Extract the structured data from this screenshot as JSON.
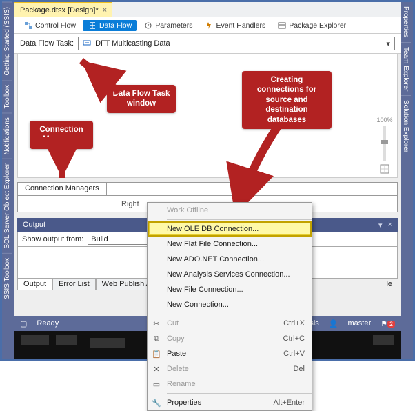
{
  "left_rail": [
    "Getting Started (SSIS)",
    "Toolbox",
    "Notifications",
    "SQL Server Object Explorer",
    "SSIS Toolbox"
  ],
  "right_rail": [
    "Properties",
    "Team Explorer",
    "Solution Explorer"
  ],
  "file_tab": {
    "label": "Package.dtsx [Design]*",
    "close": "×"
  },
  "subtabs": {
    "control_flow": "Control Flow",
    "data_flow": "Data Flow",
    "parameters": "Parameters",
    "event_handlers": "Event Handlers",
    "package_explorer": "Package Explorer"
  },
  "dft": {
    "label": "Data Flow Task:",
    "value": "DFT Multicasting Data"
  },
  "zoom": {
    "pct": "100%"
  },
  "callouts": {
    "c1": "Connection Managers",
    "c2": "Data Flow Task window",
    "c3": "Creating connections for source and destination databases"
  },
  "connection_managers": {
    "tab": "Connection Managers",
    "hint_prefix": "Right"
  },
  "output": {
    "title": "Output",
    "show_label": "Show output from:",
    "show_value": "Build",
    "tabs": [
      "Output",
      "Error List",
      "Web Publish Activity"
    ],
    "trailing": "le"
  },
  "status": {
    "ready": "Ready",
    "db": "ata-ssis",
    "user": "master",
    "notif_count": "2"
  },
  "context_menu": {
    "work_offline": "Work Offline",
    "new_oledb": "New OLE DB Connection...",
    "new_flat": "New Flat File Connection...",
    "new_ado": "New ADO.NET Connection...",
    "new_as": "New Analysis Services Connection...",
    "new_file": "New File Connection...",
    "new_conn": "New Connection...",
    "cut": "Cut",
    "cut_sc": "Ctrl+X",
    "copy": "Copy",
    "copy_sc": "Ctrl+C",
    "paste": "Paste",
    "paste_sc": "Ctrl+V",
    "delete": "Delete",
    "delete_sc": "Del",
    "rename": "Rename",
    "properties": "Properties",
    "properties_sc": "Alt+Enter"
  }
}
